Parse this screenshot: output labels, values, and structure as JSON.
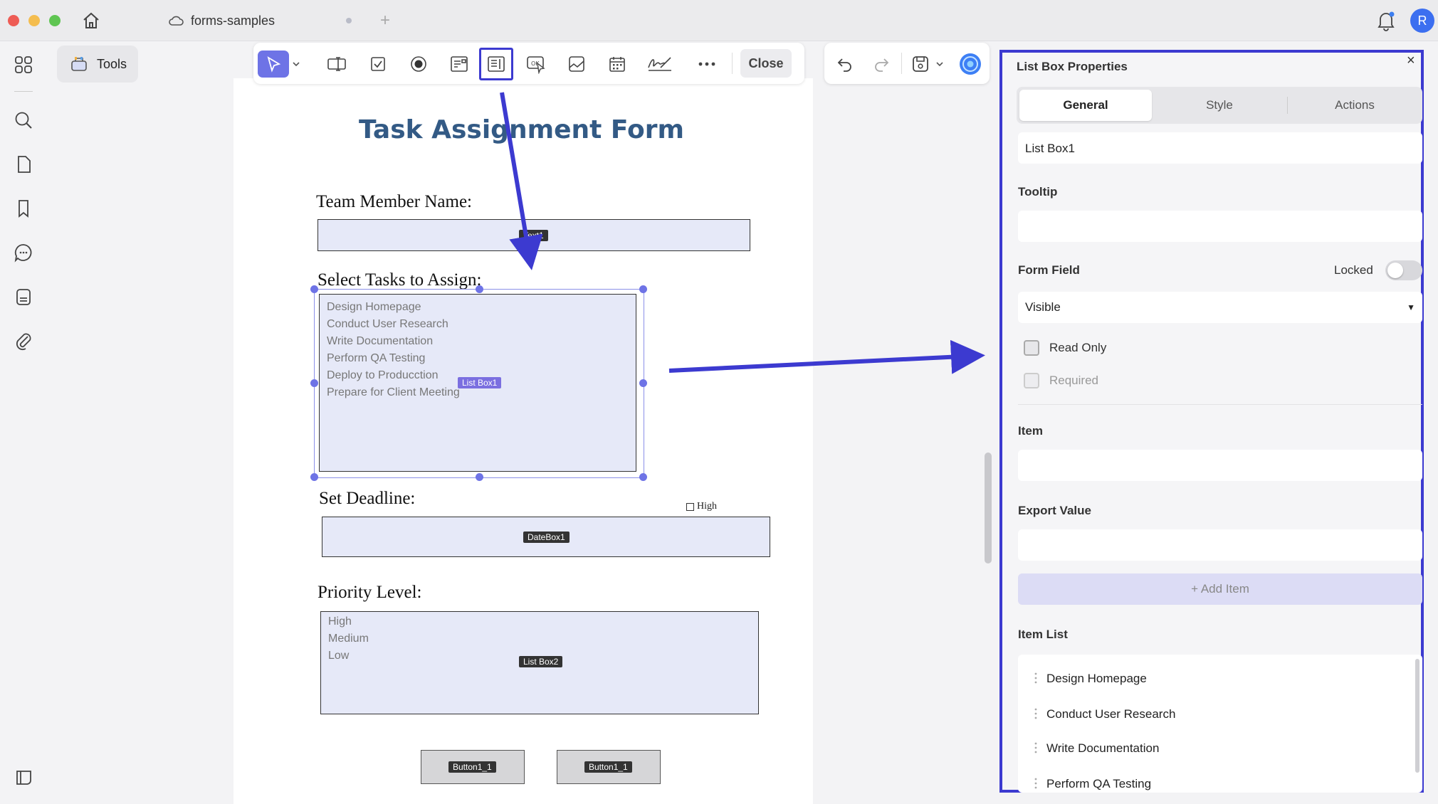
{
  "window": {
    "tab_title": "forms-samples",
    "new_tab_symbol": "+",
    "avatar_initial": "R"
  },
  "sidebar": {
    "tools_label": "Tools"
  },
  "toolbar": {
    "close_label": "Close"
  },
  "form": {
    "title": "Task Assignment Form",
    "team_member_label": "Team Member Name:",
    "text_field_tag": "Text1",
    "select_tasks_label": "Select Tasks to Assign:",
    "list_box1_items": [
      "Design Homepage",
      "Conduct User Research",
      "Write Documentation",
      "Perform QA Testing",
      "Deploy to Producction",
      "Prepare for Client Meeting"
    ],
    "list_box1_tag": "List Box1",
    "deadline_label": "Set Deadline:",
    "high_checkbox_label": "High",
    "date_tag": "DateBox1",
    "priority_label": "Priority Level:",
    "list_box2_items": [
      "High",
      "Medium",
      "Low"
    ],
    "list_box2_tag": "List Box2",
    "button1_tag": "Button1_1",
    "button2_tag": "Button1_1"
  },
  "panel": {
    "title": "List Box Properties",
    "close_symbol": "×",
    "tabs": [
      "General",
      "Style",
      "Actions"
    ],
    "name_value": "List Box1",
    "tooltip_label": "Tooltip",
    "tooltip_value": "",
    "form_field_label": "Form Field",
    "locked_label": "Locked",
    "visibility_value": "Visible",
    "read_only_label": "Read Only",
    "required_label": "Required",
    "item_label": "Item",
    "item_value": "",
    "export_value_label": "Export Value",
    "export_value": "",
    "add_item_label": "+ Add Item",
    "item_list_label": "Item List",
    "item_list": [
      "Design Homepage",
      "Conduct User Research",
      "Write Documentation",
      "Perform QA Testing"
    ]
  },
  "colors": {
    "accent": "#3c3ad0",
    "selection": "#6e73e6",
    "title_blue": "#335a85",
    "field_fill": "#e6e9f8"
  }
}
